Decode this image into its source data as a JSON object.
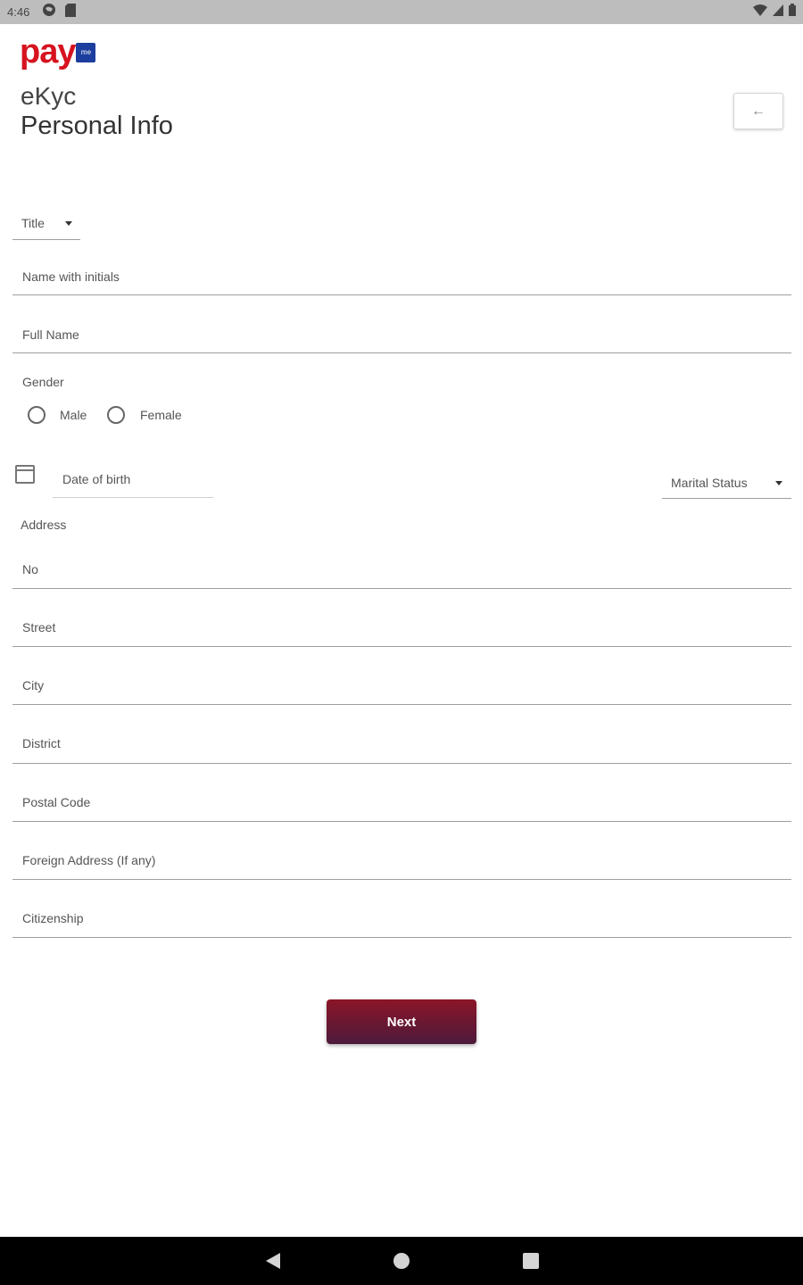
{
  "status_bar": {
    "time": "4:46",
    "left_icons": [
      "globe-icon",
      "sd-card-icon"
    ],
    "right_icons": [
      "wifi-icon",
      "signal-icon",
      "battery-icon"
    ]
  },
  "header": {
    "logo_text": "pay",
    "logo_badge": "me",
    "subtitle": "eKyc",
    "title": "Personal Info",
    "back_icon": "←"
  },
  "form": {
    "title_select": {
      "label": "Title"
    },
    "name_with_initials": {
      "label": "Name with initials"
    },
    "full_name": {
      "label": "Full Name"
    },
    "gender": {
      "label": "Gender",
      "options": [
        "Male",
        "Female"
      ]
    },
    "date_of_birth": {
      "label": "Date of birth"
    },
    "marital_status": {
      "label": "Marital Status"
    },
    "address": {
      "heading": "Address",
      "no": "No",
      "street": "Street",
      "city": "City",
      "district": "District",
      "postal_code": "Postal Code"
    },
    "foreign_address": {
      "label": "Foreign Address (If any)"
    },
    "citizenship": {
      "label": "Citizenship"
    },
    "next_button": "Next"
  },
  "colors": {
    "brand_red": "#d6131f",
    "brand_blue": "#1c3e9e",
    "button_top": "#8b1528",
    "button_bottom": "#4d1a3b"
  }
}
